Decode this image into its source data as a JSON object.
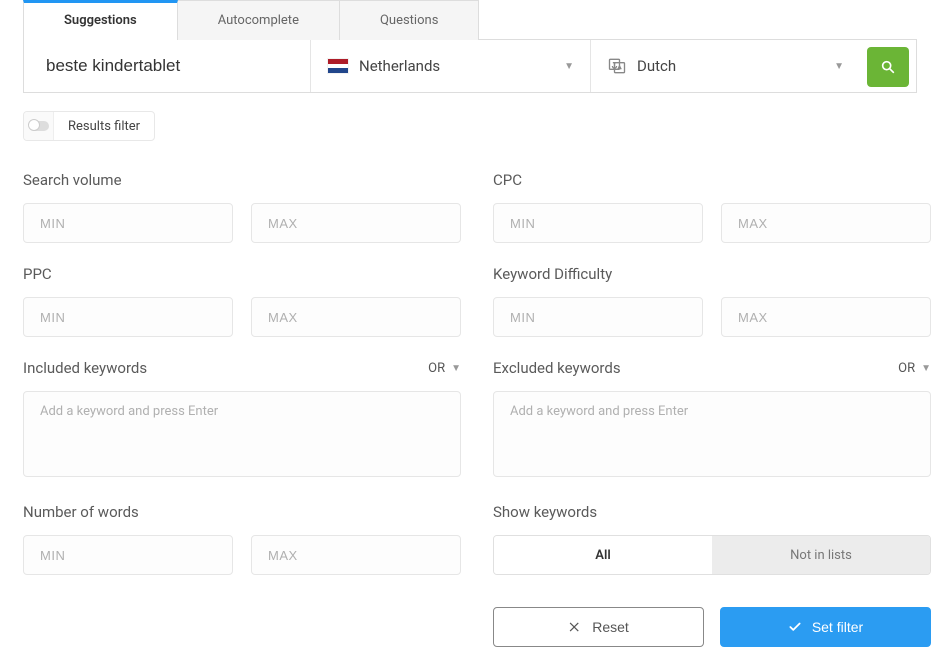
{
  "tabs": {
    "suggestions": "Suggestions",
    "autocomplete": "Autocomplete",
    "questions": "Questions"
  },
  "search": {
    "value": "beste kindertablet",
    "country": "Netherlands",
    "language": "Dutch"
  },
  "results_filter": {
    "label": "Results filter"
  },
  "filters": {
    "search_volume": {
      "label": "Search volume"
    },
    "cpc": {
      "label": "CPC"
    },
    "ppc": {
      "label": "PPC"
    },
    "keyword_difficulty": {
      "label": "Keyword Difficulty"
    },
    "included": {
      "label": "Included keywords",
      "logic": "OR"
    },
    "excluded": {
      "label": "Excluded keywords",
      "logic": "OR"
    },
    "num_words": {
      "label": "Number of words"
    },
    "show_keywords": {
      "label": "Show keywords",
      "all": "All",
      "not_in_lists": "Not in lists"
    }
  },
  "placeholders": {
    "min": "MIN",
    "max": "MAX",
    "add_keyword": "Add a keyword and press Enter"
  },
  "buttons": {
    "reset": "Reset",
    "set_filter": "Set filter"
  }
}
